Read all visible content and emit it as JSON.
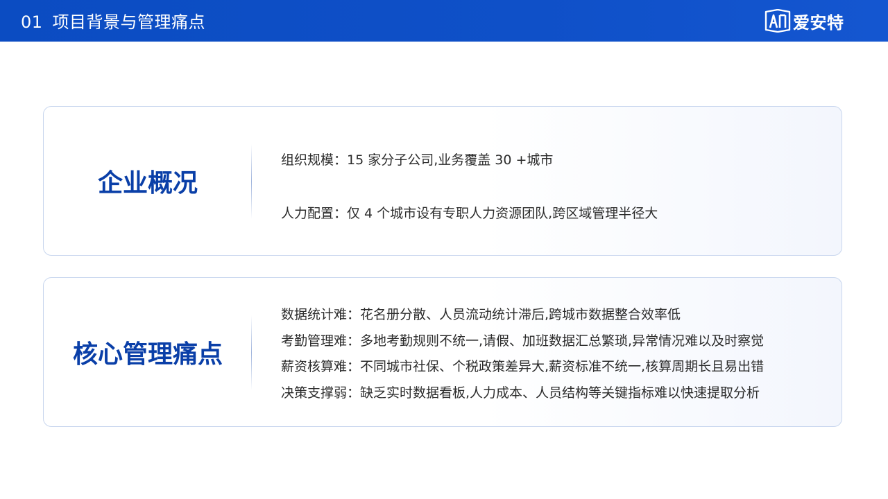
{
  "header": {
    "number": "01",
    "title": "项目背景与管理痛点",
    "logo_text": "爱安特"
  },
  "overview": {
    "label": "企业概况",
    "lines": [
      "组织规模：15 家分子公司,业务覆盖 30 +城市",
      "人力配置：仅 4 个城市设有专职人力资源团队,跨区域管理半径大"
    ]
  },
  "pain_points": {
    "label": "核心管理痛点",
    "lines": [
      "数据统计难：花名册分散、人员流动统计滞后,跨城市数据整合效率低",
      "考勤管理难：多地考勤规则不统一,请假、加班数据汇总繁琐,异常情况难以及时察觉",
      "薪资核算难：不同城市社保、个税政策差异大,薪资标准不统一,核算周期长且易出错",
      "决策支撑弱：缺乏实时数据看板,人力成本、人员结构等关键指标难以快速提取分析"
    ]
  },
  "colors": {
    "header_bg": "#0f50c8",
    "accent_text": "#0a3fa8",
    "card_border": "#c8d6ee"
  }
}
